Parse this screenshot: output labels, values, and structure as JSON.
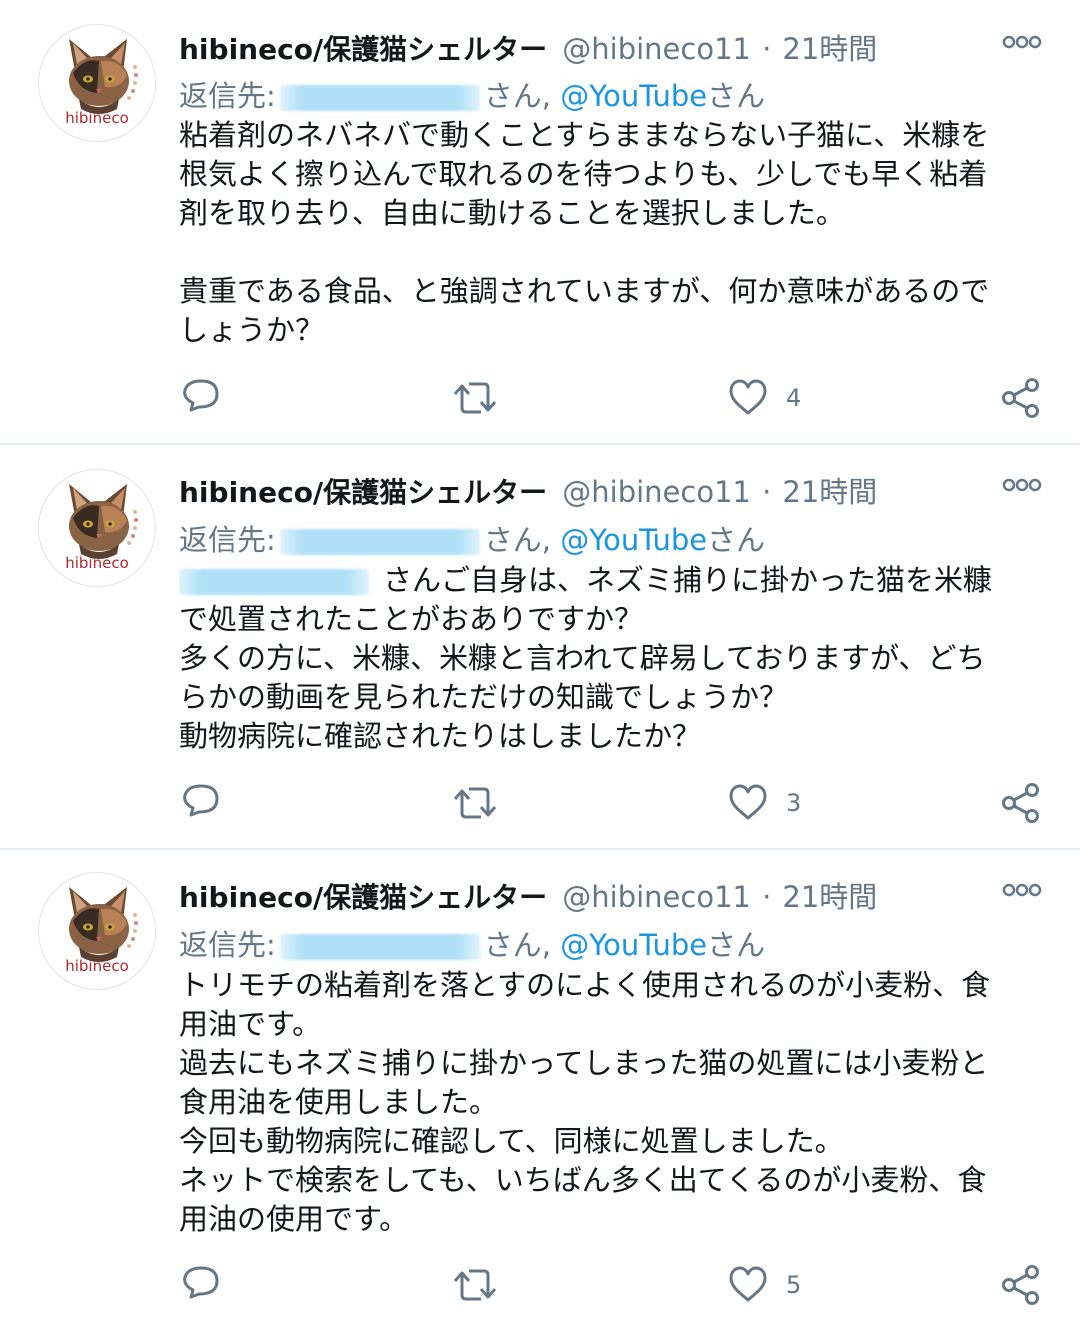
{
  "tweets": [
    {
      "name": "hibineco/保護猫シェルター",
      "handle": "@hibineco11",
      "time": "21時間",
      "reply_prefix": "返信先:",
      "reply_san1": "さん,",
      "reply_mention": "@YouTube",
      "reply_san2": "さん",
      "body": [
        "粘着剤のネバネバで動くことすらままならない子猫に、米糠を",
        "根気よく擦り込んで取れるのを待つよりも、少しでも早く粘着",
        "剤を取り去り、自由に動けることを選択しました。",
        "",
        "貴重である食品、と強調されていますが、何か意味があるので",
        "しょうか？"
      ],
      "likes": "4",
      "avatar_label": "hibineco"
    },
    {
      "name": "hibineco/保護猫シェルター",
      "handle": "@hibineco11",
      "time": "21時間",
      "reply_prefix": "返信先:",
      "reply_san1": "さん,",
      "reply_mention": "@YouTube",
      "reply_san2": "さん",
      "body_first_suffix": "さんご自身は、ネズミ捕りに掛かった猫を米糠",
      "body": [
        "で処置されたことがおありですか？",
        "多くの方に、米糠、米糠と言われて辟易しておりますが、どち",
        "らかの動画を見られただけの知識でしょうか？",
        "動物病院に確認されたりはしましたか？"
      ],
      "likes": "3",
      "avatar_label": "hibineco"
    },
    {
      "name": "hibineco/保護猫シェルター",
      "handle": "@hibineco11",
      "time": "21時間",
      "reply_prefix": "返信先:",
      "reply_san1": "さん,",
      "reply_mention": "@YouTube",
      "reply_san2": "さん",
      "body": [
        "トリモチの粘着剤を落とすのによく使用されるのが小麦粉、食",
        "用油です。",
        "過去にもネズミ捕りに掛かってしまった猫の処置には小麦粉と",
        "食用油を使用しました。",
        "今回も動物病院に確認して、同様に処置しました。",
        "ネットで検索をしても、いちばん多く出てくるのが小麦粉、食",
        "用油の使用です。"
      ],
      "likes": "5",
      "avatar_label": "hibineco"
    }
  ],
  "colors": {
    "text": "#14171a",
    "muted": "#657786",
    "link": "#1b95e0",
    "divider": "#e6ecf0",
    "avatar_text": "#b0282e"
  },
  "icons": [
    "more-icon",
    "reply-icon",
    "retweet-icon",
    "like-icon",
    "share-icon"
  ]
}
